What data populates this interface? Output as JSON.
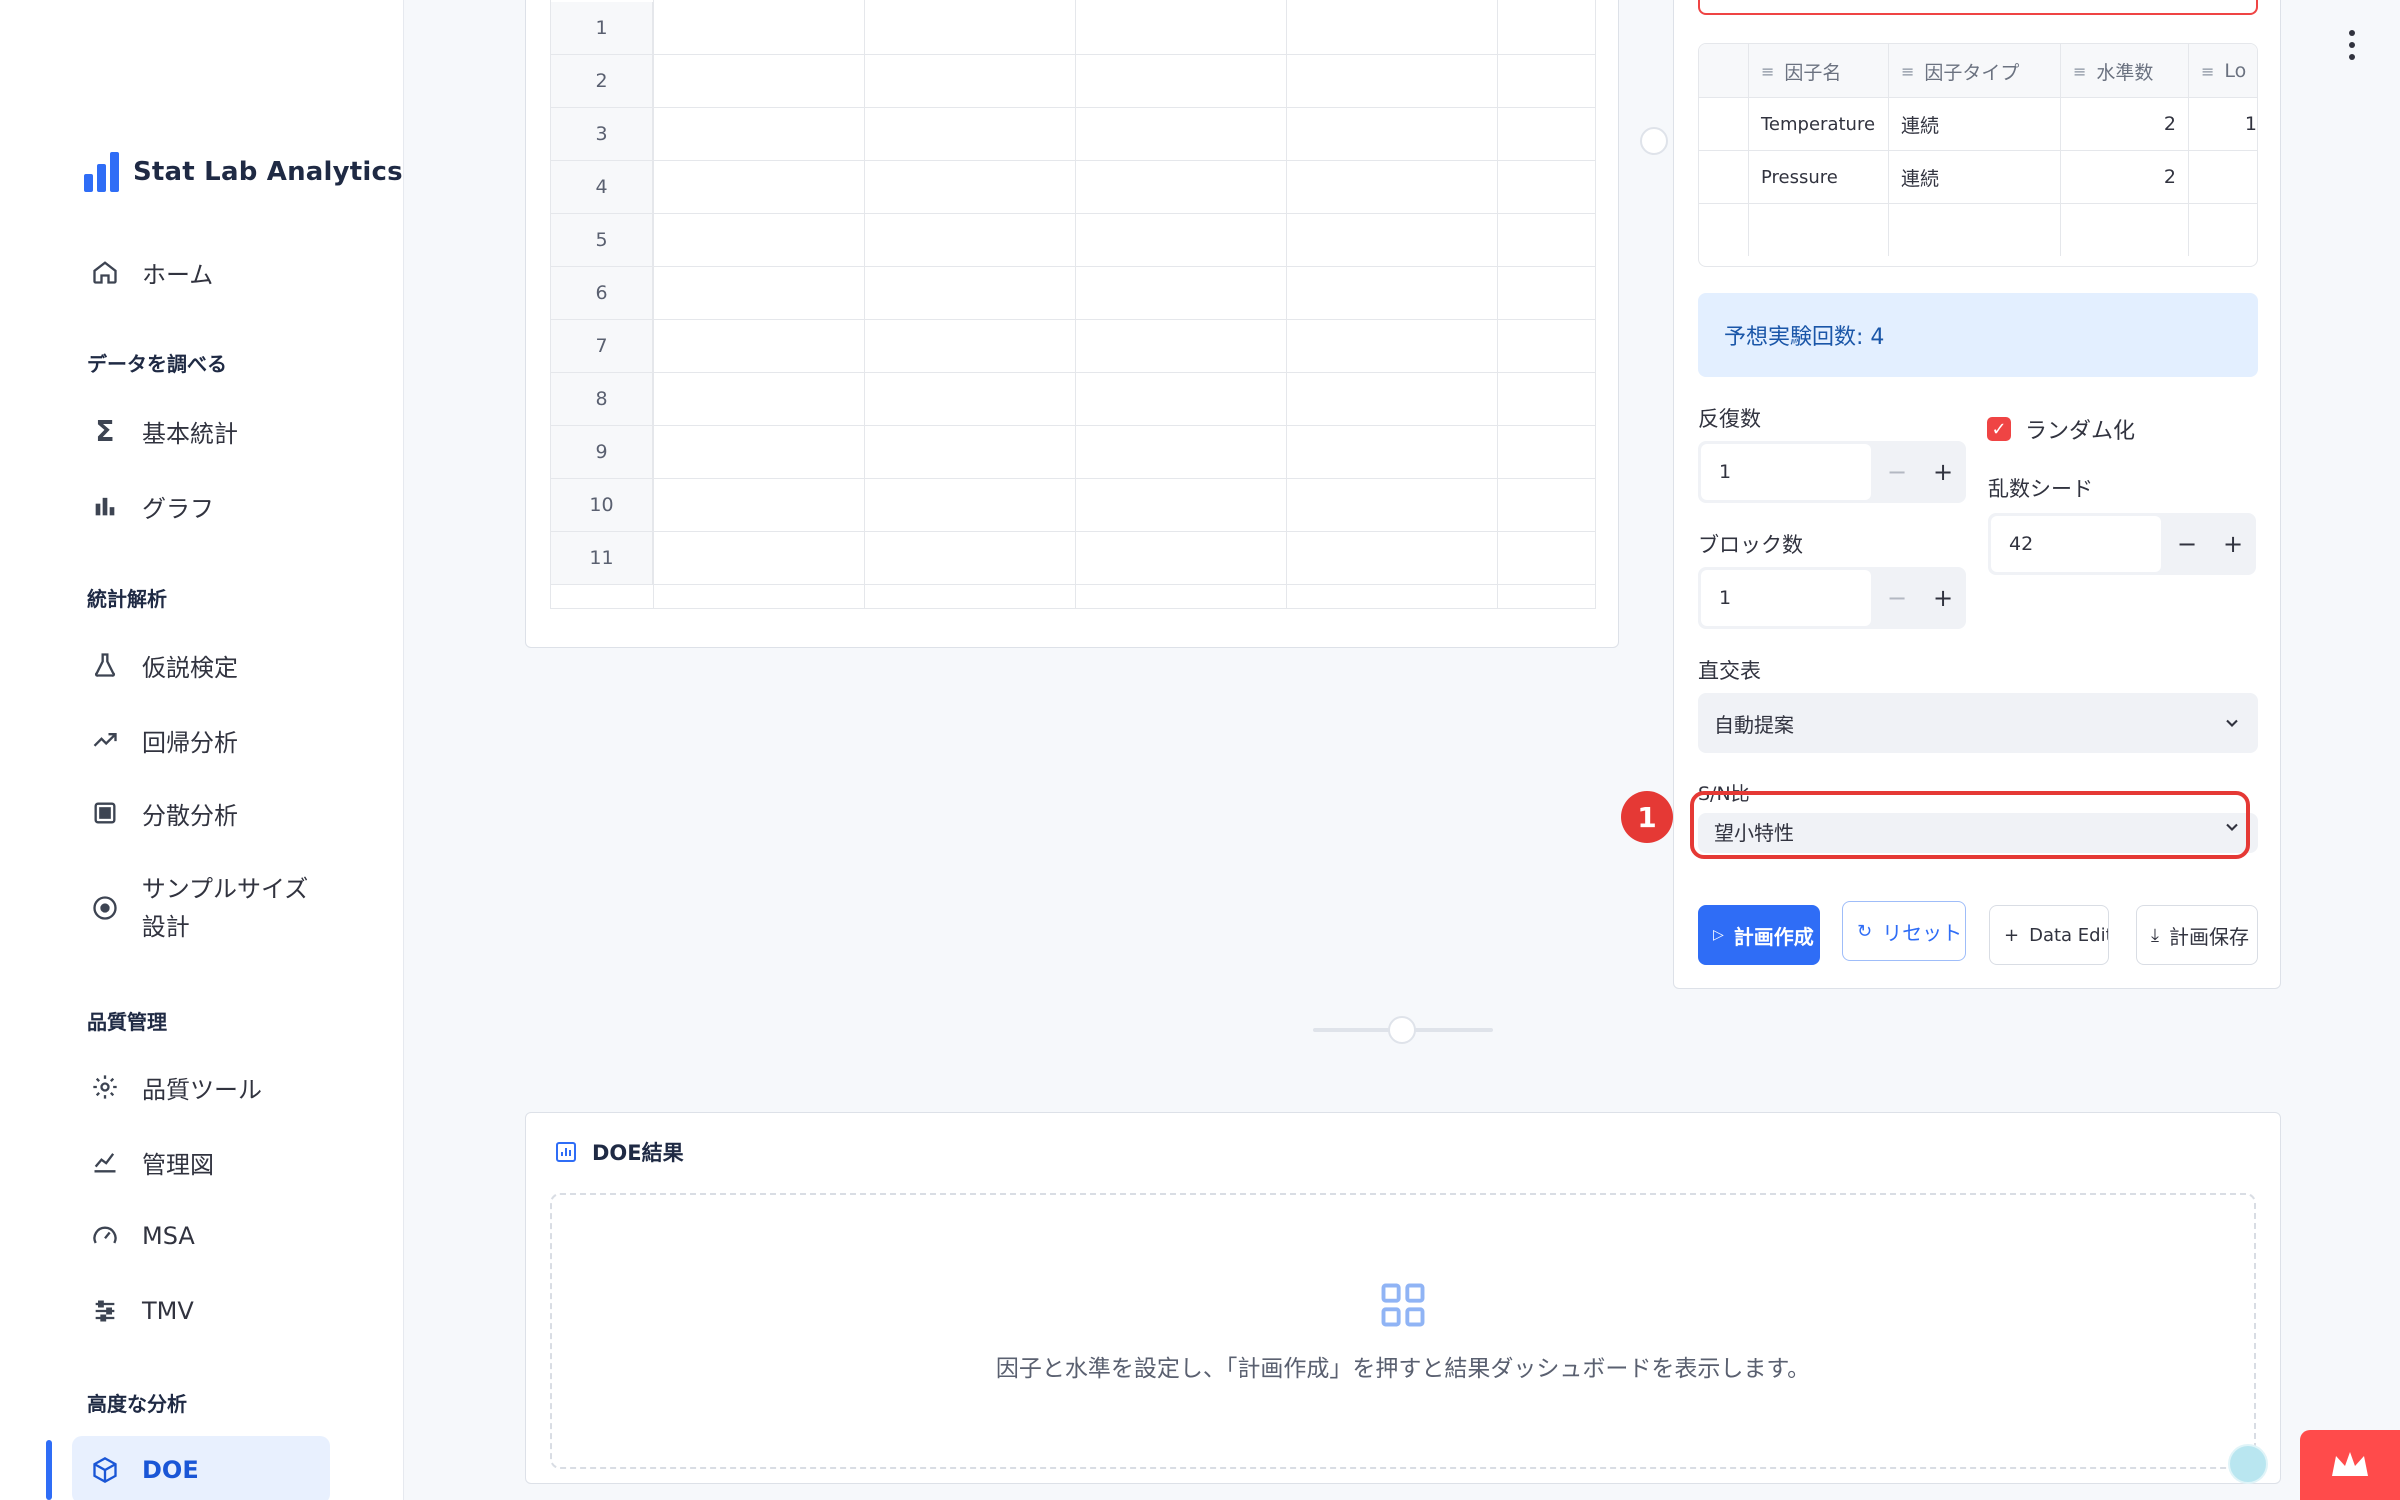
{
  "app": {
    "title": "Stat Lab Analytics"
  },
  "sidebar": {
    "home": "ホーム",
    "sections": {
      "explore": "データを調べる",
      "stats": "統計解析",
      "quality": "品質管理",
      "advanced": "高度な分析"
    },
    "items": {
      "basic_stats": "基本統計",
      "graph": "グラフ",
      "hypothesis": "仮説検定",
      "regression": "回帰分析",
      "anova": "分散分析",
      "sample_size": "サンプルサイズ設計",
      "quality_tools": "品質ツール",
      "control_chart": "管理図",
      "msa": "MSA",
      "tmv": "TMV",
      "doe": "DOE"
    }
  },
  "grid": {
    "row_numbers": [
      "1",
      "2",
      "3",
      "4",
      "5",
      "6",
      "7",
      "8",
      "9",
      "10",
      "11"
    ]
  },
  "factors": {
    "headers": [
      "因子名",
      "因子タイプ",
      "水準数",
      "Lo"
    ],
    "rows": [
      {
        "name": "Temperature",
        "type": "連続",
        "levels": "2",
        "low": "1"
      },
      {
        "name": "Pressure",
        "type": "連続",
        "levels": "2",
        "low": ""
      }
    ]
  },
  "info": {
    "expected_runs": "予想実験回数: 4"
  },
  "settings": {
    "replicates_label": "反復数",
    "replicates_value": "1",
    "blocks_label": "ブロック数",
    "blocks_value": "1",
    "randomize_label": "ランダム化",
    "seed_label": "乱数シード",
    "seed_value": "42",
    "orthogonal_label": "直交表",
    "orthogonal_value": "自動提案",
    "sn_label": "S/N比",
    "sn_value": "望小特性",
    "minus": "−",
    "plus": "+"
  },
  "annotation": {
    "badge": "1"
  },
  "buttons": {
    "create": "計画作成",
    "reset": "リセット",
    "data_editor": "Data Editor",
    "save": "計画保存"
  },
  "results": {
    "title": "DOE結果",
    "empty_text": "因子と水準を設定し、「計画作成」を押すと結果ダッシュボードを表示します。"
  },
  "colors": {
    "accent": "#2f6df6",
    "highlight": "#e53935",
    "info_bg": "#e3efff"
  }
}
